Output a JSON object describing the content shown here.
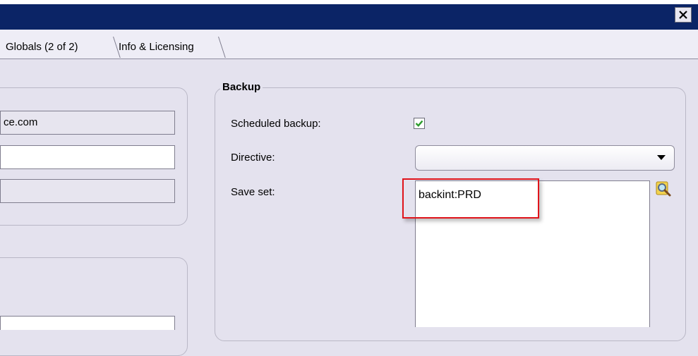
{
  "window": {
    "close_glyph": "✕"
  },
  "tabs": [
    {
      "label": "Globals (2 of 2)"
    },
    {
      "label": "Info & Licensing"
    }
  ],
  "left_panel": {
    "hostname_value": "ce.com"
  },
  "backup": {
    "title": "Backup",
    "scheduled_label": "Scheduled backup:",
    "scheduled_checked": true,
    "directive_label": "Directive:",
    "directive_value": "",
    "saveset_label": "Save set:",
    "saveset_value": "backint:PRD"
  },
  "colors": {
    "titlebar": "#0b2466",
    "background": "#e4e2ee",
    "highlight": "#e0141b",
    "check": "#2c9b2c"
  },
  "icons": [
    "close-icon",
    "check-icon",
    "chevron-down-icon",
    "browse-magnifier-icon"
  ]
}
